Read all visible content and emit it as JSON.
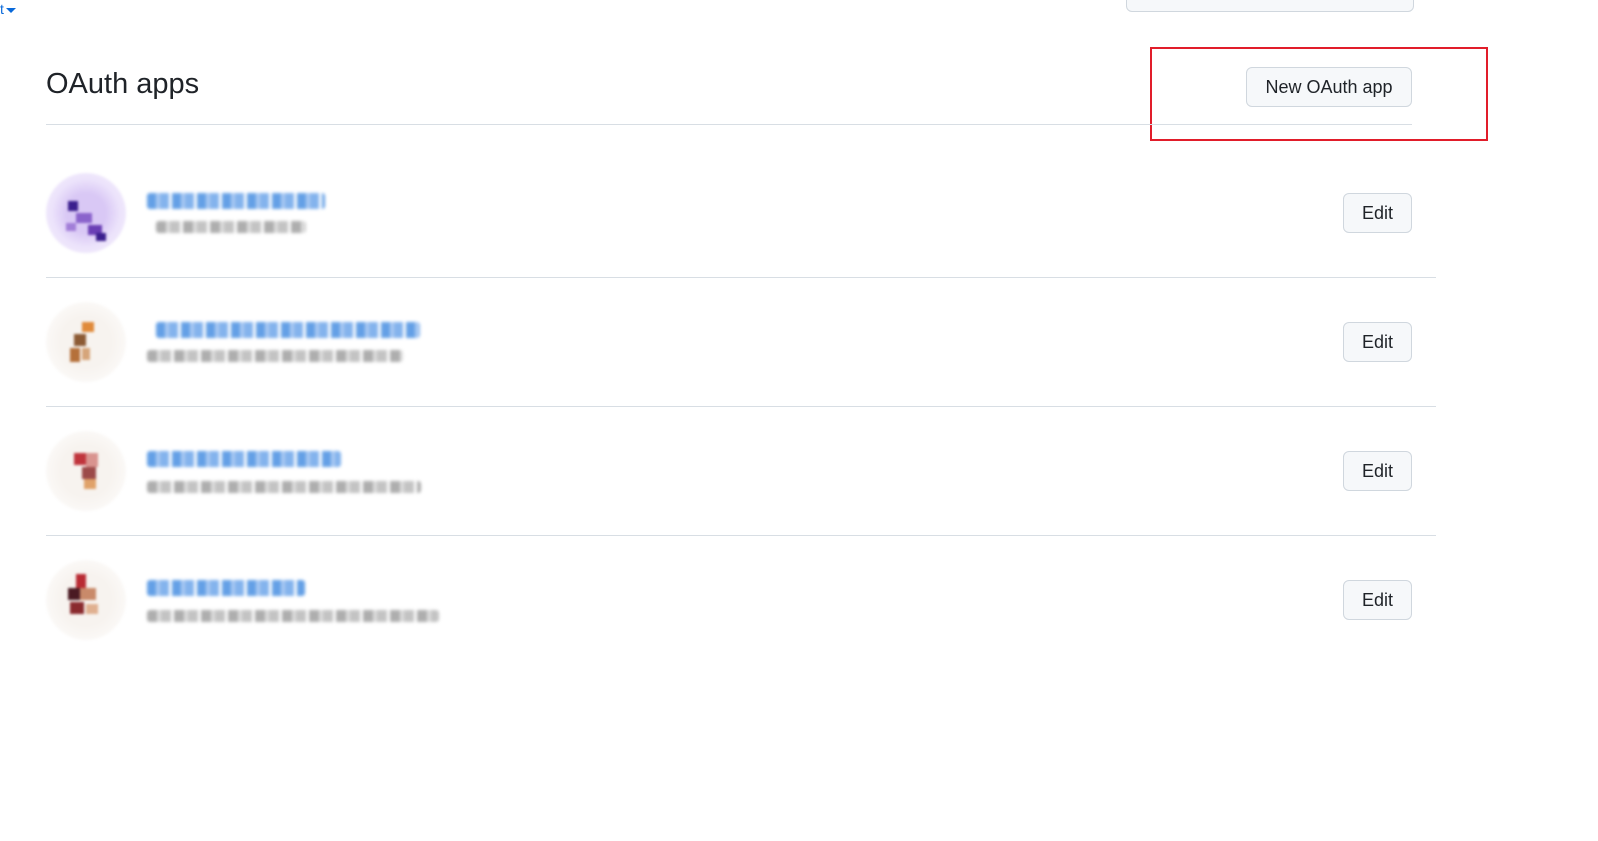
{
  "top_link": {
    "label": "t"
  },
  "header": {
    "title": "OAuth apps"
  },
  "actions": {
    "new_app_label": "New OAuth app"
  },
  "apps": [
    {
      "edit_label": "Edit",
      "avatar_colors": [
        "#ece3fb",
        "#6a3fb5",
        "#3b1f8e"
      ]
    },
    {
      "edit_label": "Edit",
      "avatar_colors": [
        "#f4f1ee",
        "#e08a3a",
        "#8c5a34"
      ]
    },
    {
      "edit_label": "Edit",
      "avatar_colors": [
        "#f4f1ee",
        "#c0343c",
        "#e0a26a"
      ]
    },
    {
      "edit_label": "Edit",
      "avatar_colors": [
        "#f4f1ee",
        "#b92b33",
        "#4a1a22"
      ]
    }
  ],
  "colors": {
    "link": "#0969da",
    "highlight": "#e11d2a",
    "divider": "#d8dee4"
  }
}
